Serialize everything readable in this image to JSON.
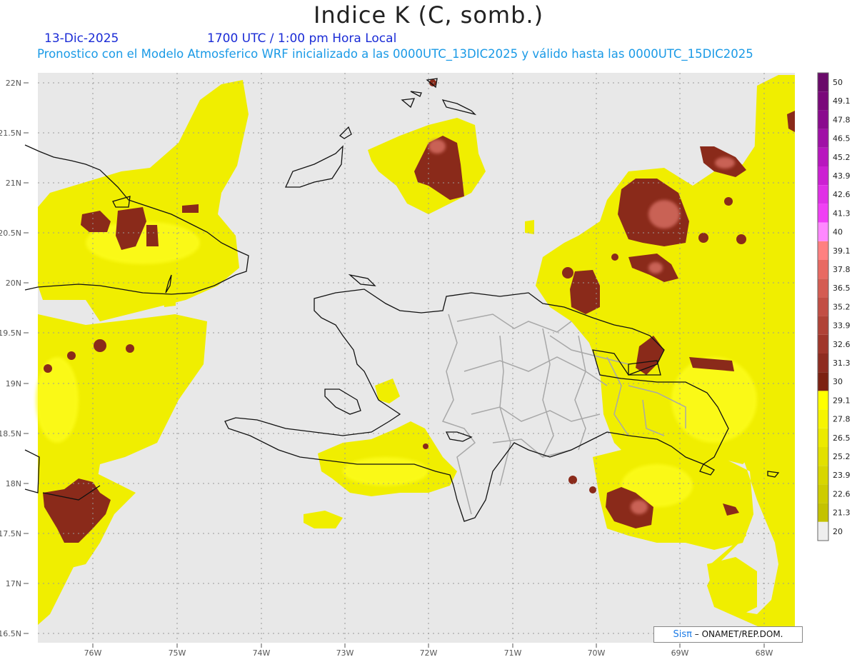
{
  "title": "Indice K (C, somb.)",
  "date": "13-Dic-2025",
  "time": "1700 UTC / 1:00 pm Hora Local",
  "description": "Pronostico con el Modelo Atmosferico WRF inicializado a las 0000UTC_13DIC2025 y válido hasta las  0000UTC_15DIC2025",
  "lat_labels": [
    "22N",
    "21.5N",
    "21N",
    "20.5N",
    "20N",
    "19.5N",
    "19N",
    "18.5N",
    "18N",
    "17.5N",
    "17N",
    "16.5N"
  ],
  "lon_labels": [
    "76W",
    "75W",
    "74W",
    "73W",
    "72W",
    "71W",
    "70W",
    "69W",
    "68W"
  ],
  "colorbar": {
    "labels": [
      "50",
      "49.1",
      "47.8",
      "46.5",
      "45.2",
      "43.9",
      "42.6",
      "41.3",
      "40",
      "39.1",
      "37.8",
      "36.5",
      "35.2",
      "33.9",
      "32.6",
      "31.3",
      "30",
      "29.1",
      "27.8",
      "26.5",
      "25.2",
      "23.9",
      "22.6",
      "21.3",
      "20"
    ],
    "colors": {
      "low": "#c6c200",
      "mid": "#f2f200",
      "high": "#ffff00",
      "brown": "#8a2a14",
      "salmon": "#e07a70",
      "pink": "#ff88aa",
      "magenta": "#d800d8",
      "purple": "#7a1a7a",
      "background": "#e8e8e8"
    }
  },
  "credit": {
    "sis": "Sisπ",
    "org": "– ONAMET/REP.DOM."
  }
}
